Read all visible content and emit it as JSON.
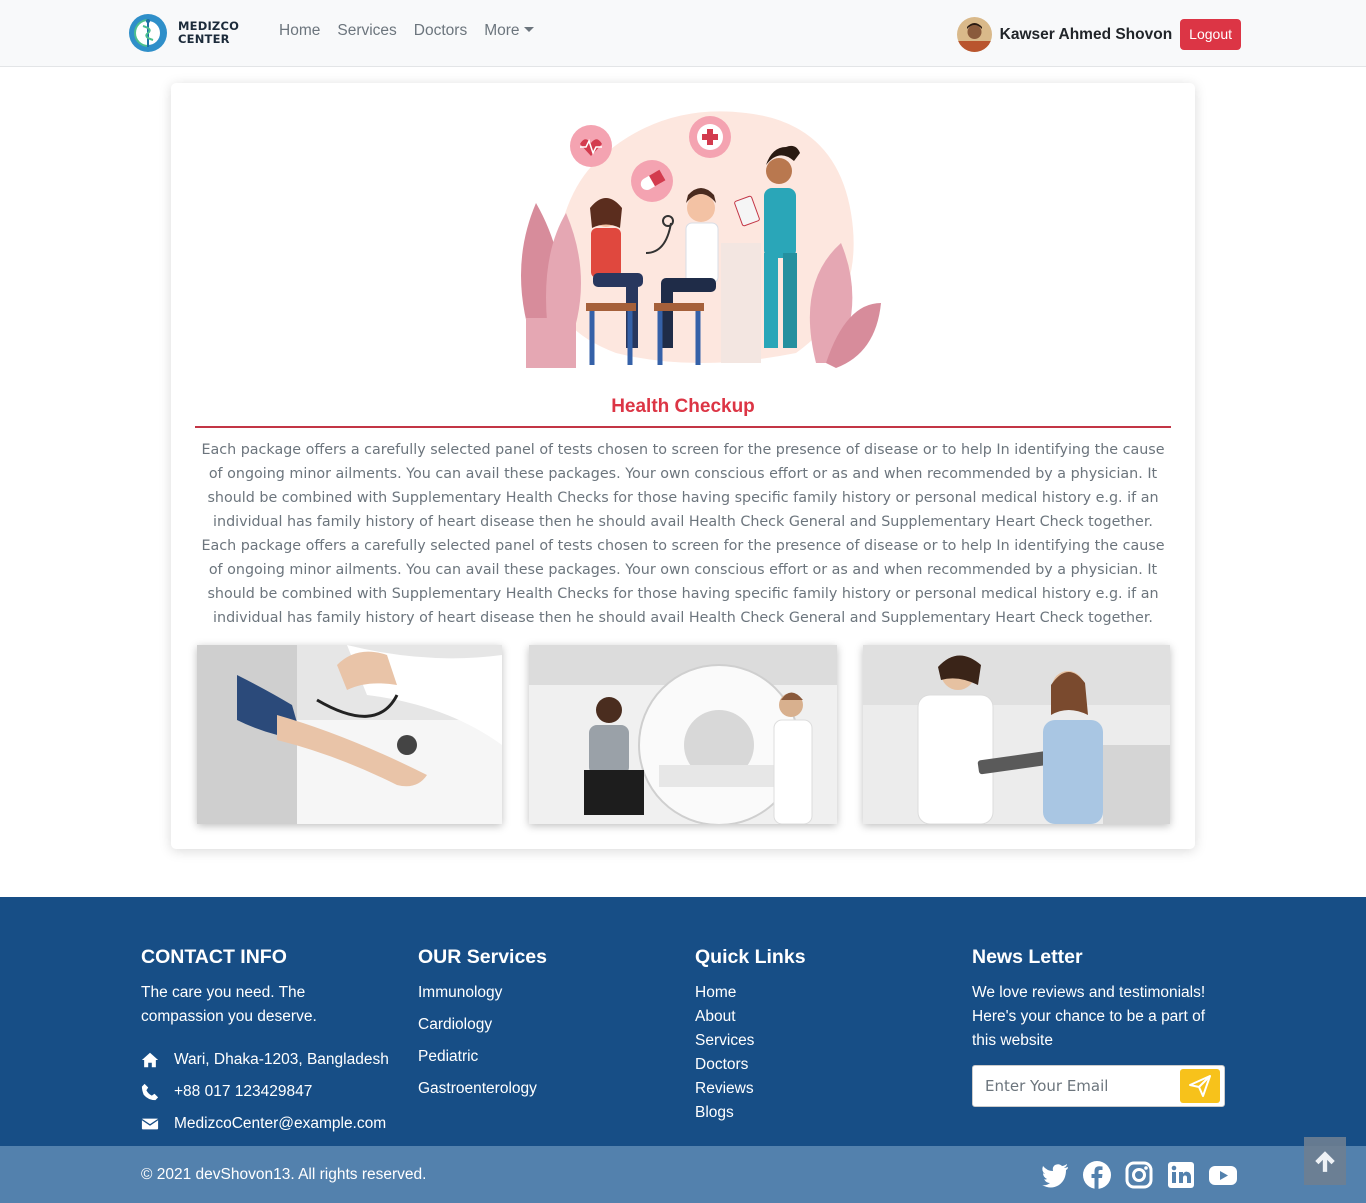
{
  "brand": {
    "line1": "MEDIZCO",
    "line2": "CENTER"
  },
  "nav": {
    "home": "Home",
    "services": "Services",
    "doctors": "Doctors",
    "more": "More"
  },
  "user": {
    "name": "Kawser Ahmed Shovon",
    "logout": "Logout"
  },
  "main": {
    "title": "Health Checkup",
    "description": "Each package offers a carefully selected panel of tests chosen to screen for the presence of disease or to help In identifying the cause of ongoing minor ailments. You can avail these packages. Your own conscious effort or as and when recommended by a physician. It should be combined with Supplementary Health Checks for those having specific family history or personal medical history e.g. if an individual has family history of heart disease then he should avail Health Check General and Supplementary Heart Check together. Each package offers a carefully selected panel of tests chosen to screen for the presence of disease or to help In identifying the cause of ongoing minor ailments. You can avail these packages. Your own conscious effort or as and when recommended by a physician. It should be combined with Supplementary Health Checks for those having specific family history or personal medical history e.g. if an individual has family history of heart disease then he should avail Health Check General and Supplementary Heart Check together."
  },
  "footer": {
    "contact": {
      "heading": "CONTACT INFO",
      "tagline": "The care you need. The compassion you deserve.",
      "address": "Wari, Dhaka-1203, Bangladesh",
      "phone": "+88 017 123429847",
      "email": "MedizcoCenter@example.com"
    },
    "services": {
      "heading": "OUR Services",
      "items": [
        "Immunology",
        "Cardiology",
        "Pediatric",
        "Gastroenterology"
      ]
    },
    "quick_links": {
      "heading": "Quick Links",
      "items": [
        "Home",
        "About",
        "Services",
        "Doctors",
        "Reviews",
        "Blogs"
      ]
    },
    "newsletter": {
      "heading": "News Letter",
      "text": "We love reviews and testimonials! Here's your chance to be a part of this website",
      "placeholder": "Enter Your Email"
    },
    "copyright": "© 2021 devShovon13. All rights reserved."
  },
  "colors": {
    "accent": "#dc3545",
    "footer_bg": "#174e86",
    "bottom_bar_bg": "#5381ad",
    "send_button": "#f7c21b"
  },
  "icons": [
    "home-icon",
    "phone-icon",
    "envelope-icon",
    "send-icon",
    "twitter-icon",
    "facebook-icon",
    "instagram-icon",
    "linkedin-icon",
    "youtube-icon",
    "arrow-up-icon"
  ]
}
